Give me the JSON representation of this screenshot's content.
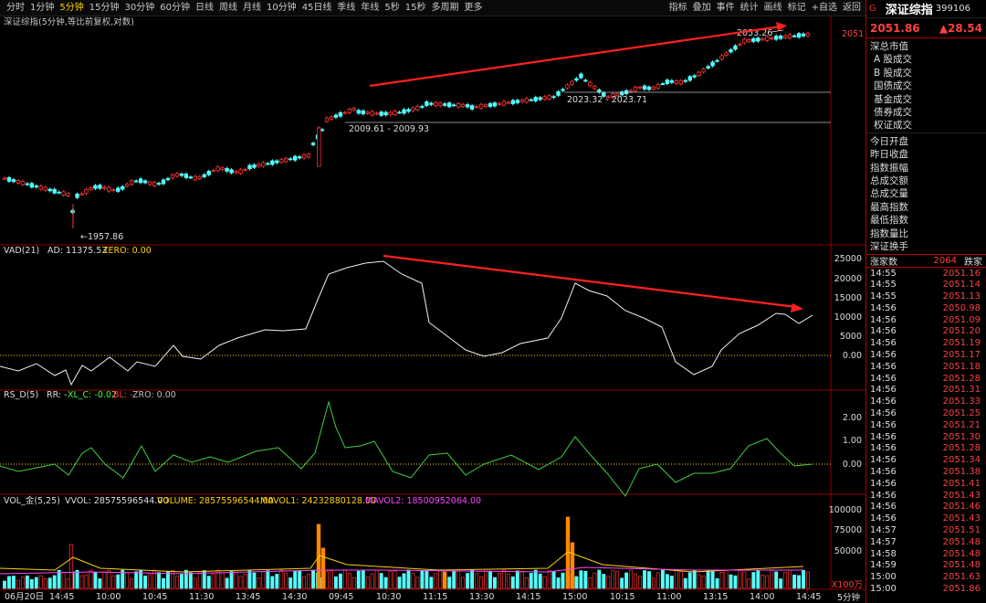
{
  "toolbar": {
    "periods": [
      "分时",
      "1分钟",
      "5分钟",
      "15分钟",
      "30分钟",
      "60分钟",
      "日线",
      "周线",
      "月线",
      "10分钟",
      "45日线",
      "季线",
      "年线",
      "5秒",
      "15秒",
      "多周期",
      "更多"
    ],
    "active_period": "5分钟",
    "tools": [
      "指标",
      "叠加",
      "事件",
      "统计",
      "画线",
      "标记",
      "+自选",
      "返回"
    ]
  },
  "sidebar": {
    "flag": "G",
    "name": "深证综指",
    "code": "399106",
    "last": "2051.86",
    "change": "▲28.54",
    "list1": [
      "深总市值",
      "A 股成交",
      "B 股成交",
      "国债成交",
      "基金成交",
      "债券成交",
      "权证成交"
    ],
    "list2": [
      "今日开盘",
      "昨日收盘",
      "指数振幅",
      "总成交额",
      "总成交量",
      "最高指数",
      "最低指数",
      "指数量比",
      "深证换手"
    ],
    "adv_label": "涨家数",
    "adv_value": "2064",
    "decl_label": "跌家",
    "ticks": [
      [
        "14:55",
        "2051.16"
      ],
      [
        "14:55",
        "2051.14"
      ],
      [
        "14:55",
        "2051.13"
      ],
      [
        "14:56",
        "2050.98"
      ],
      [
        "14:56",
        "2051.09"
      ],
      [
        "14:56",
        "2051.20"
      ],
      [
        "14:56",
        "2051.19"
      ],
      [
        "14:56",
        "2051.17"
      ],
      [
        "14:56",
        "2051.18"
      ],
      [
        "14:56",
        "2051.28"
      ],
      [
        "14:56",
        "2051.31"
      ],
      [
        "14:56",
        "2051.33"
      ],
      [
        "14:56",
        "2051.25"
      ],
      [
        "14:56",
        "2051.21"
      ],
      [
        "14:56",
        "2051.30"
      ],
      [
        "14:56",
        "2051.28"
      ],
      [
        "14:56",
        "2051.34"
      ],
      [
        "14:56",
        "2051.38"
      ],
      [
        "14:56",
        "2051.41"
      ],
      [
        "14:56",
        "2051.43"
      ],
      [
        "14:56",
        "2051.46"
      ],
      [
        "14:56",
        "2051.43"
      ],
      [
        "14:57",
        "2051.51"
      ],
      [
        "14:57",
        "2051.48"
      ],
      [
        "14:58",
        "2051.48"
      ],
      [
        "14:59",
        "2051.48"
      ],
      [
        "15:00",
        "2051.63"
      ],
      [
        "15:00",
        "2051.86"
      ]
    ]
  },
  "main_panel": {
    "title": "深证综指(5分钟,等比前复权,对数)",
    "price_tag": "2051",
    "labels": {
      "low": "1957.86",
      "high": "2053.26",
      "range1": "2009.61 - 2009.93",
      "range2": "2023.32 - 2023.71"
    },
    "colors": {
      "up": "#ff3232",
      "down": "#54ffff",
      "arrow": "#ff2020"
    }
  },
  "vad_panel": {
    "name": "VAD(21)",
    "ad_label": "AD: 11375.53",
    "zero_label": "ZERO: 0.00",
    "axis": [
      "25000",
      "20000",
      "15000",
      "10000",
      "5000",
      "0.00"
    ]
  },
  "rsd_panel": {
    "name": "RS_D(5)",
    "rr_label": "RR: -",
    "xl_label": "XL_C: -0.02",
    "bl_label": "BL: -",
    "zro_label": "ZRO: 0.00",
    "axis": [
      "2.00",
      "1.00",
      "0.00"
    ]
  },
  "vol_panel": {
    "name": "VOL_金(5,25)",
    "vvol_label": "VVOL: 28575596544.00",
    "volume_label": "VOLUME: 28575596544.00",
    "mavol1_label": "MAVOL1: 24232880128.00",
    "mavol2_label": "MAVOL2: 18500952064.00",
    "axis": [
      "100000",
      "75000",
      "50000"
    ],
    "unit": "X100万"
  },
  "xaxis": {
    "labels": [
      "06月20日",
      "14:45",
      "10:00",
      "10:45",
      "11:30",
      "13:45",
      "14:30",
      "09:45",
      "10:30",
      "11:15",
      "13:30",
      "14:15",
      "15:00",
      "10:15",
      "11:00",
      "13:15",
      "14:00",
      "14:45"
    ],
    "period_label": "5分钟"
  }
}
